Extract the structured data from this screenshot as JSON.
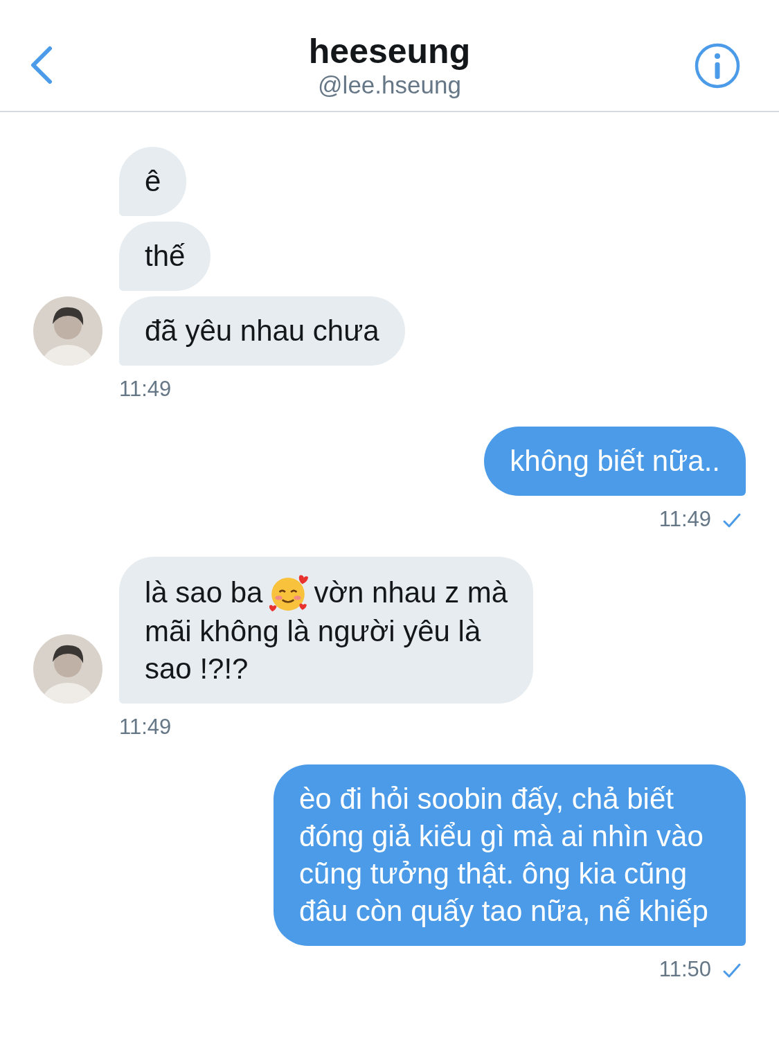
{
  "header": {
    "name": "heeseung",
    "handle": "@lee.hseung"
  },
  "groups": [
    {
      "kind": "received",
      "messages": [
        {
          "lines": [
            [
              "ê"
            ]
          ]
        },
        {
          "lines": [
            [
              "thế"
            ]
          ]
        },
        {
          "lines": [
            [
              "đã yêu nhau chưa"
            ]
          ]
        }
      ],
      "time": "11:49",
      "seen": false
    },
    {
      "kind": "sent",
      "messages": [
        {
          "lines": [
            [
              "không biết nữa.."
            ]
          ]
        }
      ],
      "time": "11:49",
      "seen": true
    },
    {
      "kind": "received",
      "messages": [
        {
          "lines": [
            [
              "là sao ba",
              "vờn nhau z mà"
            ],
            [
              "mãi không là người yêu là"
            ],
            [
              "sao !?!?"
            ]
          ]
        }
      ],
      "time": "11:49",
      "seen": false
    },
    {
      "kind": "sent",
      "messages": [
        {
          "lines": [
            [
              "èo đi hỏi soobin đấy, chả biết đóng giả kiểu gì mà ai nhìn vào cũng tưởng thật. ông kia cũng đâu còn quấy tao nữa, nể khiếp"
            ]
          ]
        }
      ],
      "time": "11:50",
      "seen": true
    }
  ]
}
